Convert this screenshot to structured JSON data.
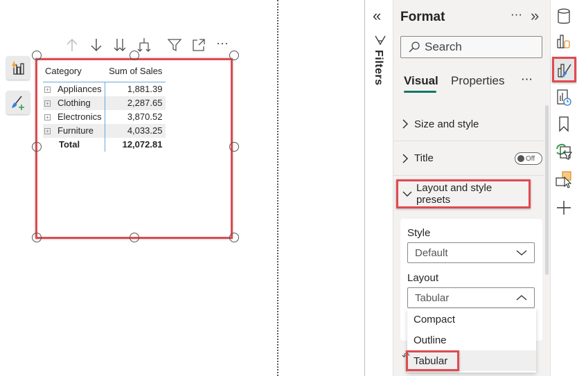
{
  "visual_header": {
    "icons": [
      "arrow-up-icon",
      "arrow-down-icon",
      "double-arrow-down-icon",
      "expand-hierarchy-icon",
      "filter-icon",
      "focus-mode-icon",
      "more-options-icon"
    ],
    "more_label": "⋯"
  },
  "side_buttons": [
    "quick-insights-icon",
    "format-painter-add-icon"
  ],
  "matrix": {
    "headers": [
      "Category",
      "Sum of Sales"
    ],
    "rows": [
      {
        "category": "Appliances",
        "value": "1,881.39"
      },
      {
        "category": "Clothing",
        "value": "2,287.65"
      },
      {
        "category": "Electronics",
        "value": "3,870.52"
      },
      {
        "category": "Furniture",
        "value": "4,033.25"
      }
    ],
    "total": {
      "label": "Total",
      "value": "12,072.81"
    },
    "expand_glyph": "+"
  },
  "filters": {
    "collapse_glyph": "«",
    "label": "Filters"
  },
  "format_pane": {
    "title": "Format",
    "more_glyph": "⋯",
    "expand_glyph": "»",
    "search_placeholder": "Search",
    "tabs": [
      {
        "label": "Visual",
        "active": true
      },
      {
        "label": "Properties",
        "active": false
      }
    ],
    "tabs_more": "⋯",
    "sections": {
      "size_style": "Size and style",
      "title": "Title",
      "title_toggle": "Off",
      "layout_presets": "Layout and style presets"
    },
    "style_label": "Style",
    "style_value": "Default",
    "layout_label": "Layout",
    "layout_value": "Tabular",
    "layout_options": [
      "Compact",
      "Outline",
      "Tabular"
    ],
    "selected_option": "Tabular"
  },
  "right_rail": [
    "data-icon",
    "build-visual-icon",
    "format-visual-icon",
    "analytics-icon",
    "bookmark-icon",
    "sync-slicers-icon",
    "selection-icon",
    "add-icon"
  ],
  "colors": {
    "highlight": "#e04a4f",
    "accent": "#117865",
    "table_divider": "#6aa9d6"
  }
}
